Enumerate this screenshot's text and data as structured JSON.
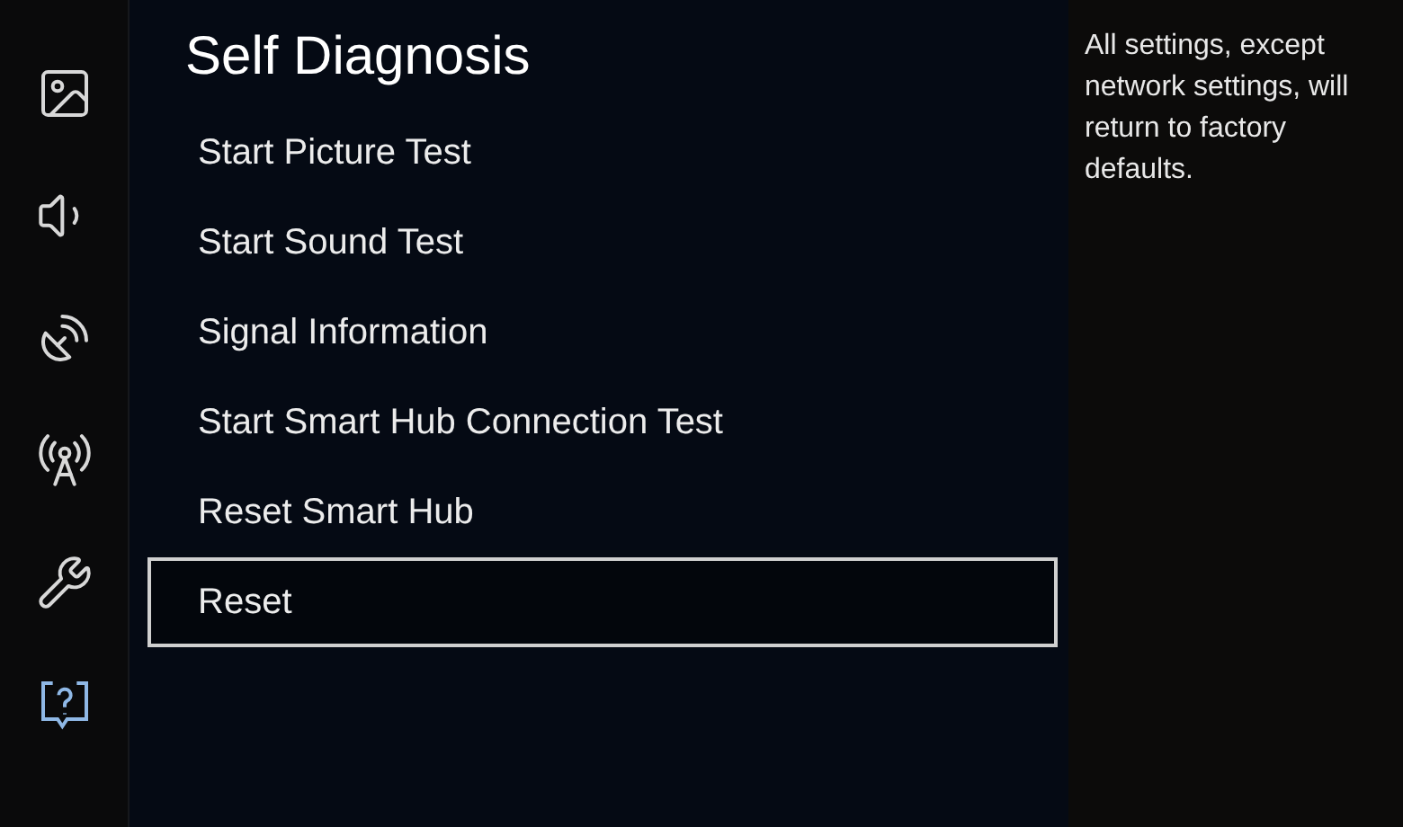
{
  "sidebar": {
    "items": [
      {
        "kind": "picture",
        "selected": false
      },
      {
        "kind": "sound",
        "selected": false
      },
      {
        "kind": "broadcasting",
        "selected": false
      },
      {
        "kind": "network",
        "selected": false
      },
      {
        "kind": "general",
        "selected": false
      },
      {
        "kind": "support",
        "selected": true
      }
    ]
  },
  "menu": {
    "title": "Self Diagnosis",
    "items": [
      {
        "label": "Start Picture Test",
        "selected": false
      },
      {
        "label": "Start Sound Test",
        "selected": false
      },
      {
        "label": "Signal Information",
        "selected": false
      },
      {
        "label": "Start Smart Hub Connection Test",
        "selected": false
      },
      {
        "label": "Reset Smart Hub",
        "selected": false
      },
      {
        "label": "Reset",
        "selected": true
      }
    ]
  },
  "description": "All settings, except network settings, will return to factory defaults."
}
